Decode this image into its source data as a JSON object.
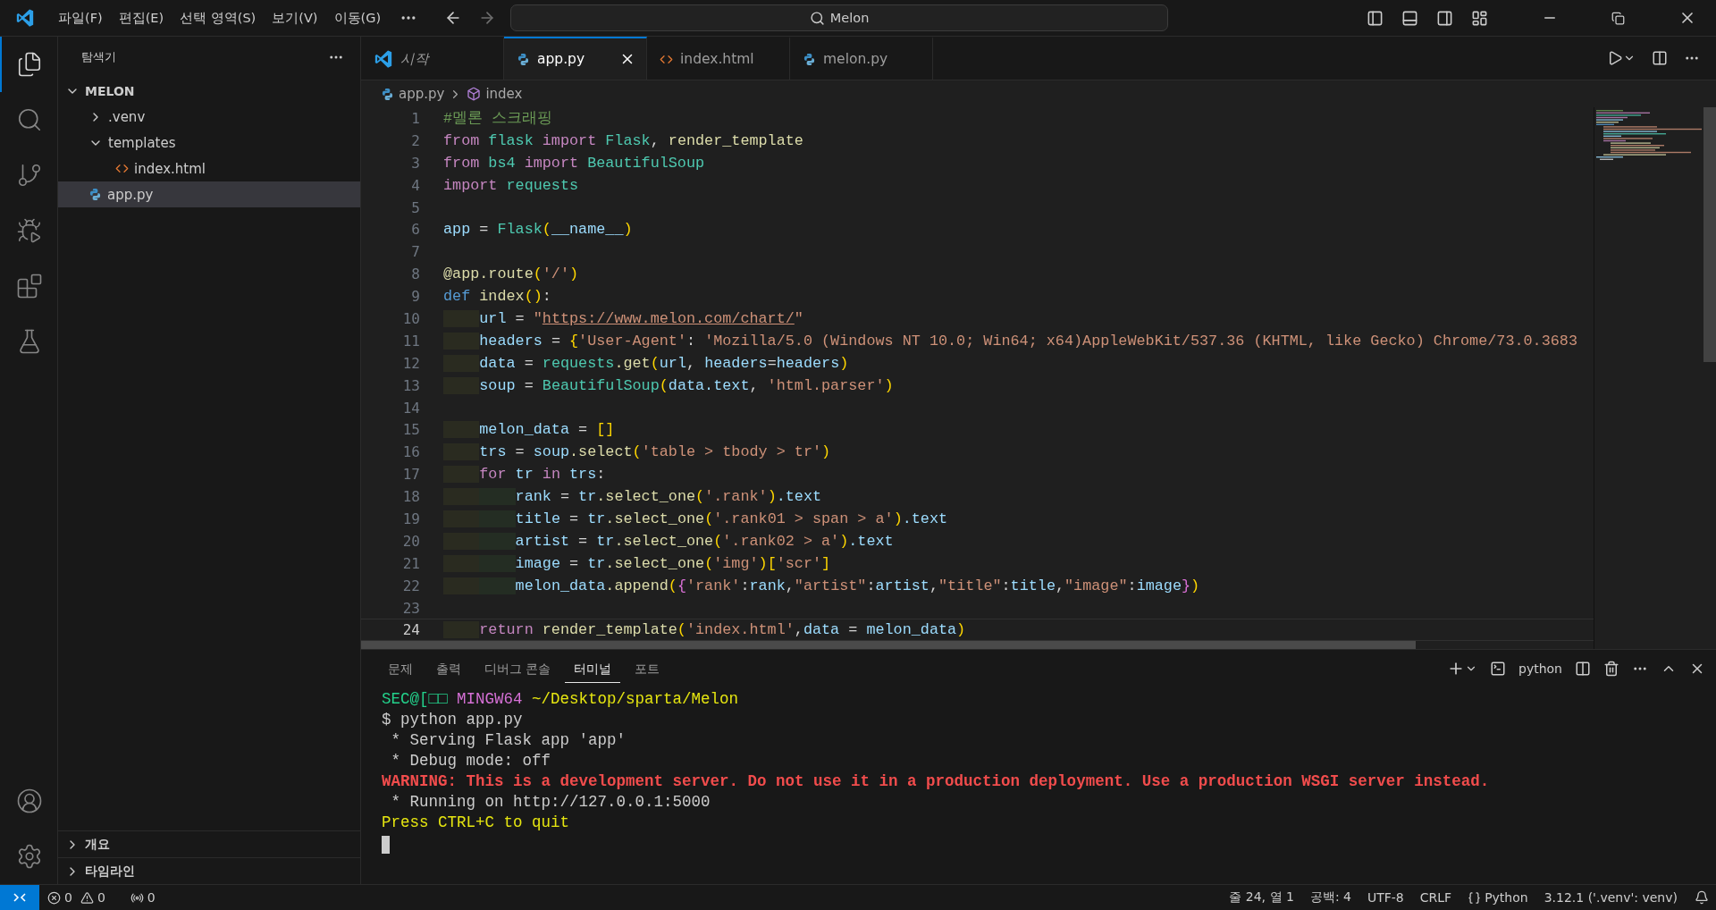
{
  "titlebar": {
    "menus": [
      "파일(F)",
      "편집(E)",
      "선택 영역(S)",
      "보기(V)",
      "이동(G)"
    ],
    "search": {
      "value": "Melon"
    }
  },
  "activity": {
    "top": [
      {
        "kind": "files",
        "selected": true
      },
      {
        "kind": "search",
        "selected": false
      },
      {
        "kind": "scm",
        "selected": false
      },
      {
        "kind": "debug",
        "selected": false
      },
      {
        "kind": "extensions",
        "selected": false
      },
      {
        "kind": "testing",
        "selected": false
      }
    ],
    "bottom": [
      {
        "kind": "account"
      },
      {
        "kind": "settings"
      }
    ]
  },
  "explorer": {
    "title": "탐색기",
    "section": {
      "title": "MELON",
      "expanded": true,
      "items": [
        {
          "label": ".venv",
          "kind": "folder",
          "expanded": false,
          "selected": false
        },
        {
          "label": "templates",
          "kind": "folder",
          "expanded": true,
          "selected": false,
          "children": [
            {
              "label": "index.html",
              "kind": "html",
              "selected": false
            }
          ]
        },
        {
          "label": "app.py",
          "kind": "python",
          "selected": true
        }
      ]
    },
    "bottom_sections": [
      {
        "title": "개요",
        "expanded": false
      },
      {
        "title": "타임라인",
        "expanded": false
      }
    ]
  },
  "editor": {
    "tabs": [
      {
        "label": "시작",
        "kind": "welcome",
        "selected": false
      },
      {
        "label": "app.py",
        "kind": "python",
        "selected": true
      },
      {
        "label": "index.html",
        "kind": "html",
        "selected": false
      },
      {
        "label": "melon.py",
        "kind": "python",
        "selected": false
      }
    ],
    "breadcrumb": [
      {
        "label": "app.py",
        "kind": "python"
      },
      {
        "label": "index",
        "kind": "symbol"
      }
    ],
    "lines": [
      {
        "n": "1",
        "current": false,
        "tokens": [
          {
            "text": "#멜론 스크래핑",
            "color": "#6a9955"
          }
        ]
      },
      {
        "n": "2",
        "current": false,
        "tokens": [
          {
            "text": "from ",
            "color": "#c586c0"
          },
          {
            "text": "flask ",
            "color": "#4ec9b0"
          },
          {
            "text": "import ",
            "color": "#c586c0"
          },
          {
            "text": "Flask",
            "color": "#4ec9b0"
          },
          {
            "text": ", ",
            "color": "#d4d4d4"
          },
          {
            "text": "render_template",
            "color": "#dcdcaa"
          }
        ]
      },
      {
        "n": "3",
        "current": false,
        "tokens": [
          {
            "text": "from ",
            "color": "#c586c0"
          },
          {
            "text": "bs4 ",
            "color": "#4ec9b0"
          },
          {
            "text": "import ",
            "color": "#c586c0"
          },
          {
            "text": "BeautifulSoup",
            "color": "#4ec9b0"
          }
        ]
      },
      {
        "n": "4",
        "current": false,
        "tokens": [
          {
            "text": "import ",
            "color": "#c586c0"
          },
          {
            "text": "requests",
            "color": "#4ec9b0"
          }
        ]
      },
      {
        "n": "5",
        "current": false
      },
      {
        "n": "6",
        "current": false,
        "tokens": [
          {
            "text": "app ",
            "color": "#9cdcfe"
          },
          {
            "text": "= ",
            "color": "#d4d4d4"
          },
          {
            "text": "Flask",
            "color": "#4ec9b0"
          },
          {
            "text": "(",
            "color": "#ffd700"
          },
          {
            "text": "__name__",
            "color": "#9cdcfe"
          },
          {
            "text": ")",
            "color": "#ffd700"
          }
        ]
      },
      {
        "n": "7",
        "current": false
      },
      {
        "n": "8",
        "current": false,
        "tokens": [
          {
            "text": "@app.route",
            "color": "#dcdcaa"
          },
          {
            "text": "(",
            "color": "#ffd700"
          },
          {
            "text": "'/'",
            "color": "#ce9178"
          },
          {
            "text": ")",
            "color": "#ffd700"
          }
        ]
      },
      {
        "n": "9",
        "current": false,
        "tokens": [
          {
            "text": "def ",
            "color": "#569cd6"
          },
          {
            "text": "index",
            "color": "#dcdcaa"
          },
          {
            "text": "()",
            "color": "#ffd700"
          },
          {
            "text": ":",
            "color": "#d4d4d4"
          }
        ]
      },
      {
        "n": "10",
        "current": false,
        "tokens": [
          {
            "text": "    url ",
            "color": "#9cdcfe",
            "underlined": false
          },
          {
            "text": "= ",
            "color": "#d4d4d4",
            "underlined": false
          },
          {
            "text": "\"",
            "color": "#ce9178",
            "underlined": false
          },
          {
            "text": "https://www.melon.com/chart/",
            "color": "#ce9178",
            "underlined": true
          },
          {
            "text": "\"",
            "color": "#ce9178",
            "underlined": false
          }
        ]
      },
      {
        "n": "11",
        "current": false,
        "tokens": [
          {
            "text": "    headers ",
            "color": "#9cdcfe"
          },
          {
            "text": "= ",
            "color": "#d4d4d4"
          },
          {
            "text": "{",
            "color": "#ffd700"
          },
          {
            "text": "'User-Agent'",
            "color": "#ce9178"
          },
          {
            "text": ": ",
            "color": "#d4d4d4"
          },
          {
            "text": "'Mozilla/5.0 (Windows NT 10.0; Win64; x64)AppleWebKit/537.36 (KHTML, like Gecko) Chrome/73.0.3683",
            "color": "#ce9178"
          }
        ]
      },
      {
        "n": "12",
        "current": false,
        "tokens": [
          {
            "text": "    data ",
            "color": "#9cdcfe"
          },
          {
            "text": "= ",
            "color": "#d4d4d4"
          },
          {
            "text": "requests",
            "color": "#4ec9b0"
          },
          {
            "text": ".get",
            "color": "#dcdcaa"
          },
          {
            "text": "(",
            "color": "#ffd700"
          },
          {
            "text": "url",
            "color": "#9cdcfe"
          },
          {
            "text": ", ",
            "color": "#d4d4d4"
          },
          {
            "text": "headers",
            "color": "#9cdcfe"
          },
          {
            "text": "=",
            "color": "#d4d4d4"
          },
          {
            "text": "headers",
            "color": "#9cdcfe"
          },
          {
            "text": ")",
            "color": "#ffd700"
          }
        ]
      },
      {
        "n": "13",
        "current": false,
        "tokens": [
          {
            "text": "    soup ",
            "color": "#9cdcfe"
          },
          {
            "text": "= ",
            "color": "#d4d4d4"
          },
          {
            "text": "BeautifulSoup",
            "color": "#4ec9b0"
          },
          {
            "text": "(",
            "color": "#ffd700"
          },
          {
            "text": "data.text",
            "color": "#9cdcfe"
          },
          {
            "text": ", ",
            "color": "#d4d4d4"
          },
          {
            "text": "'html.parser'",
            "color": "#ce9178"
          },
          {
            "text": ")",
            "color": "#ffd700"
          }
        ]
      },
      {
        "n": "14",
        "current": false
      },
      {
        "n": "15",
        "current": false,
        "tokens": [
          {
            "text": "    melon_data ",
            "color": "#9cdcfe"
          },
          {
            "text": "= ",
            "color": "#d4d4d4"
          },
          {
            "text": "[]",
            "color": "#ffd700"
          }
        ]
      },
      {
        "n": "16",
        "current": false,
        "tokens": [
          {
            "text": "    trs ",
            "color": "#9cdcfe"
          },
          {
            "text": "= ",
            "color": "#d4d4d4"
          },
          {
            "text": "soup",
            "color": "#9cdcfe"
          },
          {
            "text": ".select",
            "color": "#dcdcaa"
          },
          {
            "text": "(",
            "color": "#ffd700"
          },
          {
            "text": "'table > tbody > tr'",
            "color": "#ce9178"
          },
          {
            "text": ")",
            "color": "#ffd700"
          }
        ]
      },
      {
        "n": "17",
        "current": false,
        "tokens": [
          {
            "text": "    for ",
            "color": "#c586c0"
          },
          {
            "text": "tr ",
            "color": "#9cdcfe"
          },
          {
            "text": "in ",
            "color": "#c586c0"
          },
          {
            "text": "trs",
            "color": "#9cdcfe"
          },
          {
            "text": ":",
            "color": "#d4d4d4"
          }
        ]
      },
      {
        "n": "18",
        "current": false,
        "tokens": [
          {
            "text": "        rank ",
            "color": "#9cdcfe"
          },
          {
            "text": "= ",
            "color": "#d4d4d4"
          },
          {
            "text": "tr",
            "color": "#9cdcfe"
          },
          {
            "text": ".select_one",
            "color": "#dcdcaa"
          },
          {
            "text": "(",
            "color": "#ffd700"
          },
          {
            "text": "'.rank'",
            "color": "#ce9178"
          },
          {
            "text": ")",
            "color": "#ffd700"
          },
          {
            "text": ".text",
            "color": "#9cdcfe"
          }
        ]
      },
      {
        "n": "19",
        "current": false,
        "tokens": [
          {
            "text": "        title ",
            "color": "#9cdcfe"
          },
          {
            "text": "= ",
            "color": "#d4d4d4"
          },
          {
            "text": "tr",
            "color": "#9cdcfe"
          },
          {
            "text": ".select_one",
            "color": "#dcdcaa"
          },
          {
            "text": "(",
            "color": "#ffd700"
          },
          {
            "text": "'.rank01 > span > a'",
            "color": "#ce9178"
          },
          {
            "text": ")",
            "color": "#ffd700"
          },
          {
            "text": ".text",
            "color": "#9cdcfe"
          }
        ]
      },
      {
        "n": "20",
        "current": false,
        "tokens": [
          {
            "text": "        artist ",
            "color": "#9cdcfe"
          },
          {
            "text": "= ",
            "color": "#d4d4d4"
          },
          {
            "text": "tr",
            "color": "#9cdcfe"
          },
          {
            "text": ".select_one",
            "color": "#dcdcaa"
          },
          {
            "text": "(",
            "color": "#ffd700"
          },
          {
            "text": "'.rank02 > a'",
            "color": "#ce9178"
          },
          {
            "text": ")",
            "color": "#ffd700"
          },
          {
            "text": ".text",
            "color": "#9cdcfe"
          }
        ]
      },
      {
        "n": "21",
        "current": false,
        "tokens": [
          {
            "text": "        image ",
            "color": "#9cdcfe"
          },
          {
            "text": "= ",
            "color": "#d4d4d4"
          },
          {
            "text": "tr",
            "color": "#9cdcfe"
          },
          {
            "text": ".select_one",
            "color": "#dcdcaa"
          },
          {
            "text": "(",
            "color": "#ffd700"
          },
          {
            "text": "'img'",
            "color": "#ce9178"
          },
          {
            "text": ")",
            "color": "#ffd700"
          },
          {
            "text": "[",
            "color": "#ffd700"
          },
          {
            "text": "'scr'",
            "color": "#ce9178"
          },
          {
            "text": "]",
            "color": "#ffd700"
          }
        ]
      },
      {
        "n": "22",
        "current": false,
        "tokens": [
          {
            "text": "        melon_data",
            "color": "#9cdcfe"
          },
          {
            "text": ".append",
            "color": "#dcdcaa"
          },
          {
            "text": "(",
            "color": "#ffd700"
          },
          {
            "text": "{",
            "color": "#da70d6"
          },
          {
            "text": "'rank'",
            "color": "#ce9178"
          },
          {
            "text": ":",
            "color": "#d4d4d4"
          },
          {
            "text": "rank",
            "color": "#9cdcfe"
          },
          {
            "text": ",",
            "color": "#d4d4d4"
          },
          {
            "text": "\"artist\"",
            "color": "#ce9178"
          },
          {
            "text": ":",
            "color": "#d4d4d4"
          },
          {
            "text": "artist",
            "color": "#9cdcfe"
          },
          {
            "text": ",",
            "color": "#d4d4d4"
          },
          {
            "text": "\"title\"",
            "color": "#ce9178"
          },
          {
            "text": ":",
            "color": "#d4d4d4"
          },
          {
            "text": "title",
            "color": "#9cdcfe"
          },
          {
            "text": ",",
            "color": "#d4d4d4"
          },
          {
            "text": "\"image\"",
            "color": "#ce9178"
          },
          {
            "text": ":",
            "color": "#d4d4d4"
          },
          {
            "text": "image",
            "color": "#9cdcfe"
          },
          {
            "text": "}",
            "color": "#da70d6"
          },
          {
            "text": ")",
            "color": "#ffd700"
          }
        ]
      },
      {
        "n": "23",
        "current": false
      },
      {
        "n": "24",
        "current": true,
        "tokens": [
          {
            "text": "    return ",
            "color": "#c586c0"
          },
          {
            "text": "render_template",
            "color": "#dcdcaa"
          },
          {
            "text": "(",
            "color": "#ffd700"
          },
          {
            "text": "'index.html'",
            "color": "#ce9178"
          },
          {
            "text": ",",
            "color": "#d4d4d4"
          },
          {
            "text": "data ",
            "color": "#9cdcfe"
          },
          {
            "text": "= ",
            "color": "#d4d4d4"
          },
          {
            "text": "melon_data",
            "color": "#9cdcfe"
          },
          {
            "text": ")",
            "color": "#ffd700"
          }
        ]
      }
    ]
  },
  "panel": {
    "tabs": [
      {
        "label": "문제",
        "selected": false
      },
      {
        "label": "출력",
        "selected": false
      },
      {
        "label": "디버그 콘솔",
        "selected": false
      },
      {
        "label": "터미널",
        "selected": true
      },
      {
        "label": "포트",
        "selected": false
      }
    ],
    "terminal_name": "python",
    "lines": [
      {
        "bold": false,
        "segments": [
          {
            "text": "SEC@[□□ ",
            "color": "#23d18b"
          },
          {
            "text": "MINGW64 ",
            "color": "#d670d6"
          },
          {
            "text": "~/Desktop/sparta/Melon",
            "color": "#e5e510"
          }
        ]
      },
      {
        "bold": false,
        "segments": [
          {
            "text": "$ python app.py",
            "color": "#cccccc"
          }
        ]
      },
      {
        "bold": false,
        "segments": [
          {
            "text": " * Serving Flask app 'app'",
            "color": "#cccccc"
          }
        ]
      },
      {
        "bold": false,
        "segments": [
          {
            "text": " * Debug mode: off",
            "color": "#cccccc"
          }
        ]
      },
      {
        "bold": true,
        "segments": [
          {
            "text": "WARNING: This is a development server. Do not use it in a production deployment. Use a production WSGI server instead.",
            "color": "#f14c4c"
          }
        ]
      },
      {
        "bold": false,
        "segments": [
          {
            "text": " * Running on http://127.0.0.1:5000",
            "color": "#cccccc"
          }
        ]
      },
      {
        "bold": false,
        "segments": [
          {
            "text": "Press CTRL+C to quit",
            "color": "#e5e510"
          }
        ]
      }
    ]
  },
  "statusbar": {
    "left": [
      {
        "kind": "errors",
        "text": "0"
      },
      {
        "kind": "warnings",
        "text": "0"
      },
      {
        "kind": "ports",
        "text": "0"
      }
    ],
    "right": [
      {
        "kind": "text",
        "text": "줄 24, 열 1"
      },
      {
        "kind": "text",
        "text": "공백: 4"
      },
      {
        "kind": "text",
        "text": "UTF-8"
      },
      {
        "kind": "text",
        "text": "CRLF"
      },
      {
        "kind": "language",
        "text": "Python"
      },
      {
        "kind": "text",
        "text": "3.12.1 ('.venv': venv)"
      },
      {
        "kind": "bell"
      }
    ]
  }
}
